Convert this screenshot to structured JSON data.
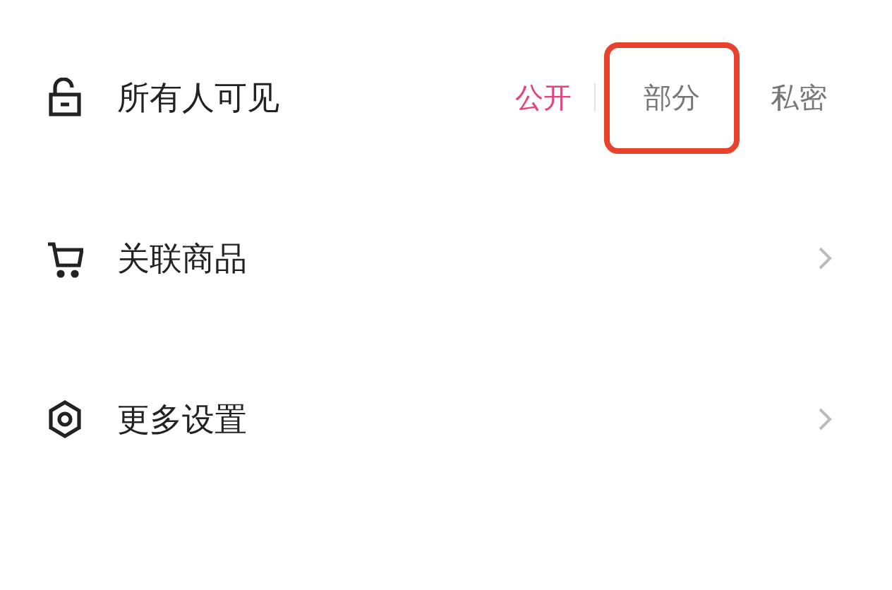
{
  "rows": [
    {
      "kind": "visibility",
      "label": "所有人可见",
      "options": [
        {
          "label": "公开",
          "selected": true,
          "outlined": false
        },
        {
          "label": "部分",
          "selected": false,
          "outlined": true
        },
        {
          "label": "私密",
          "selected": false,
          "outlined": false
        }
      ]
    },
    {
      "kind": "link",
      "label": "关联商品"
    },
    {
      "kind": "link",
      "label": "更多设置"
    }
  ]
}
